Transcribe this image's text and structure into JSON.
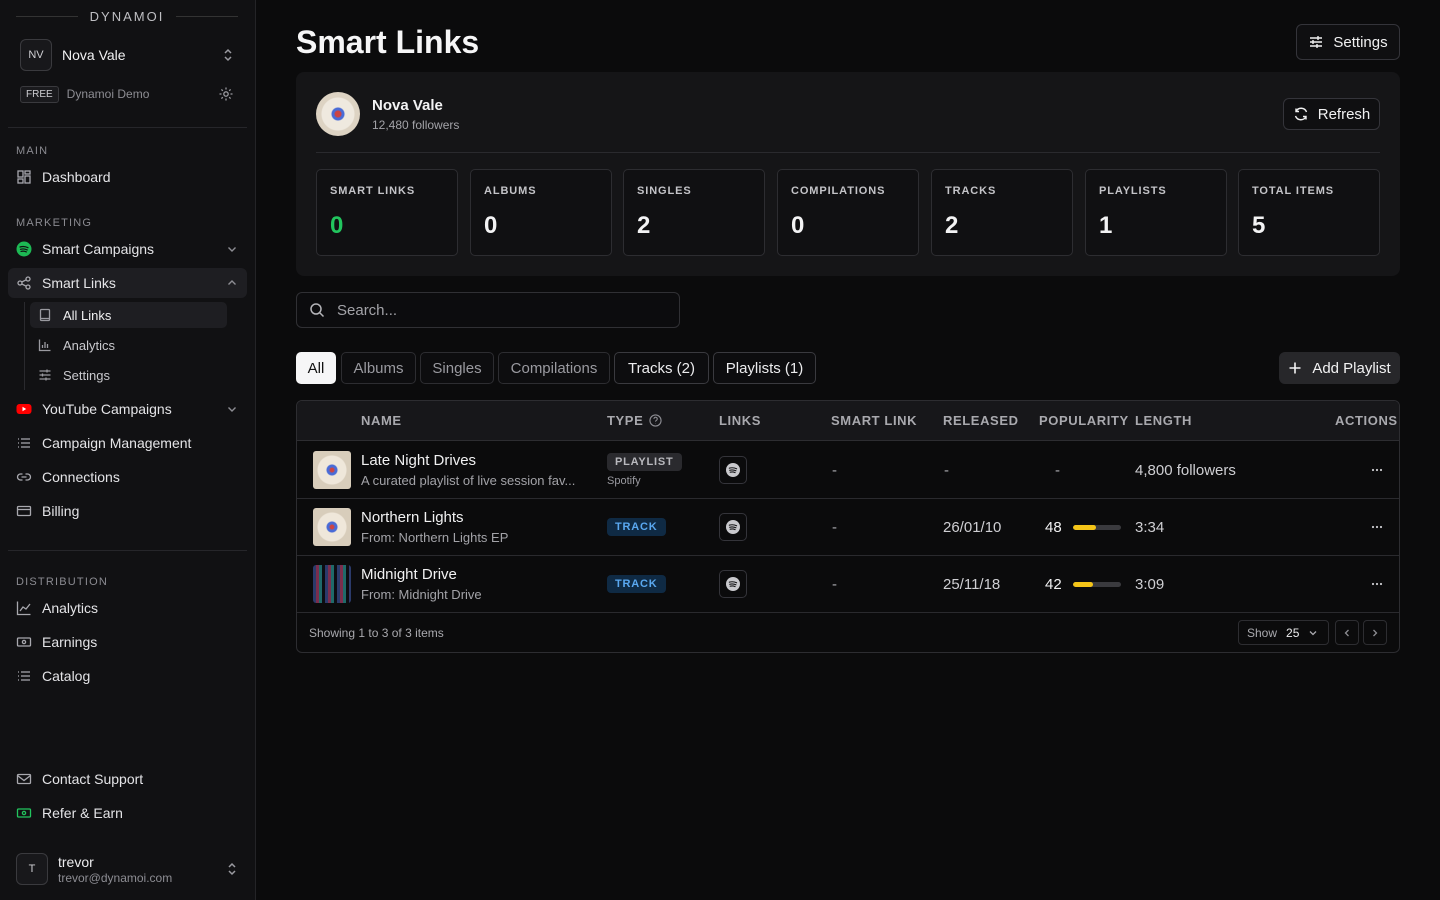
{
  "brand": "DYNAMOI",
  "org": {
    "initials": "NV",
    "name": "Nova Vale",
    "plan": "FREE",
    "workspace": "Dynamoi Demo"
  },
  "sidebar": {
    "sections": {
      "main": "MAIN",
      "marketing": "MARKETING",
      "distribution": "DISTRIBUTION"
    },
    "dashboard": "Dashboard",
    "smart_campaigns": "Smart Campaigns",
    "smart_links": "Smart Links",
    "smart_links_sub": {
      "all_links": "All Links",
      "analytics": "Analytics",
      "settings": "Settings"
    },
    "youtube_campaigns": "YouTube Campaigns",
    "campaign_management": "Campaign Management",
    "connections": "Connections",
    "billing": "Billing",
    "analytics": "Analytics",
    "earnings": "Earnings",
    "catalog": "Catalog",
    "contact_support": "Contact Support",
    "refer_earn": "Refer & Earn"
  },
  "user": {
    "initial": "T",
    "name": "trevor",
    "email": "trevor@dynamoi.com"
  },
  "page": {
    "title": "Smart Links",
    "settings_label": "Settings"
  },
  "artist": {
    "name": "Nova Vale",
    "followers": "12,480 followers",
    "refresh_label": "Refresh"
  },
  "stats": [
    {
      "label": "SMART LINKS",
      "value": "0"
    },
    {
      "label": "ALBUMS",
      "value": "0"
    },
    {
      "label": "SINGLES",
      "value": "2"
    },
    {
      "label": "COMPILATIONS",
      "value": "0"
    },
    {
      "label": "TRACKS",
      "value": "2"
    },
    {
      "label": "PLAYLISTS",
      "value": "1"
    },
    {
      "label": "TOTAL ITEMS",
      "value": "5"
    }
  ],
  "search": {
    "placeholder": "Search..."
  },
  "filters": [
    "All",
    "Albums",
    "Singles",
    "Compilations",
    "Tracks (2)",
    "Playlists (1)"
  ],
  "add_playlist_label": "Add Playlist",
  "table": {
    "headers": {
      "name": "NAME",
      "type": "TYPE",
      "links": "LINKS",
      "smart_link": "SMART LINK",
      "released": "RELEASED",
      "popularity": "POPULARITY",
      "length": "LENGTH",
      "actions": "ACTIONS"
    },
    "rows": [
      {
        "title": "Late Night Drives",
        "subtitle": "A curated playlist of live session fav...",
        "type": "PLAYLIST",
        "type_sub": "Spotify",
        "smart_link": "-",
        "released": "-",
        "popularity": "-",
        "popularity_fraction": null,
        "length": "4,800 followers"
      },
      {
        "title": "Northern Lights",
        "subtitle": "From: Northern Lights EP",
        "type": "TRACK",
        "type_sub": "",
        "smart_link": "-",
        "released": "26/01/10",
        "popularity": "48",
        "popularity_fraction": 0.48,
        "length": "3:34"
      },
      {
        "title": "Midnight Drive",
        "subtitle": "From: Midnight Drive",
        "type": "TRACK",
        "type_sub": "",
        "smart_link": "-",
        "released": "25/11/18",
        "popularity": "42",
        "popularity_fraction": 0.42,
        "length": "3:09"
      }
    ],
    "footer": {
      "showing": "Showing 1 to 3 of 3 items",
      "show_label": "Show",
      "page_size": "25"
    }
  },
  "colors": {
    "accent_green": "#22c55e",
    "popularity_bar": "#f5c518",
    "track_badge": "#5aa8f0"
  }
}
